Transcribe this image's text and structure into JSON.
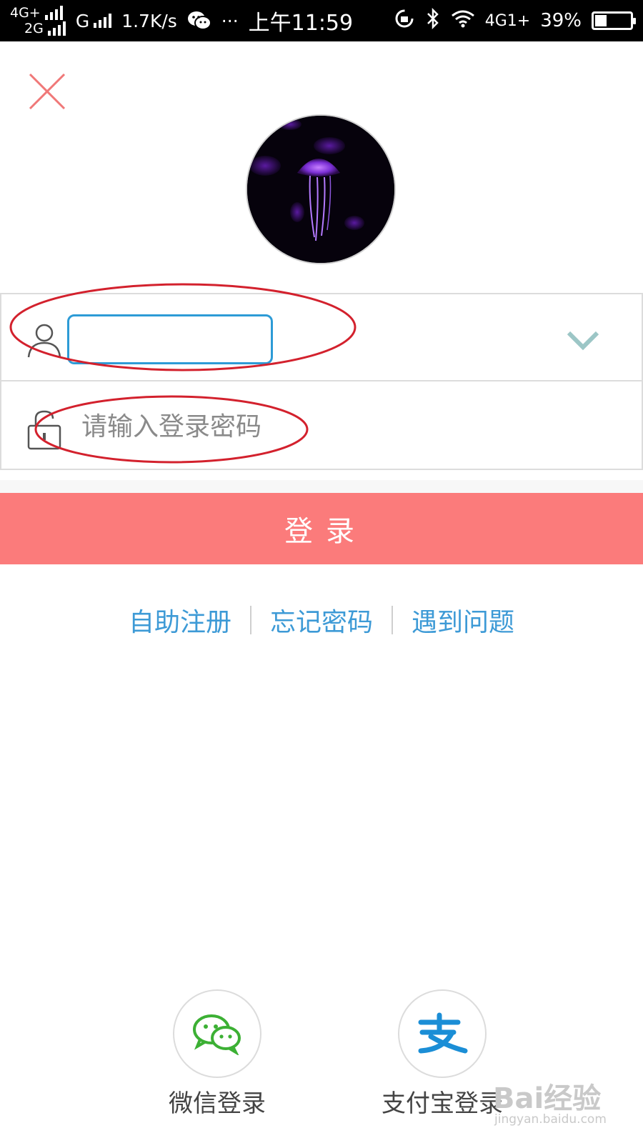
{
  "status_bar": {
    "net1": "4G+",
    "net2": "2G",
    "net3": "G",
    "speed": "1.7K/s",
    "dots": "···",
    "time": "上午11:59",
    "net_right": "4G1+",
    "battery": "39%"
  },
  "login_form": {
    "username_value": "",
    "password_placeholder": "请输入登录密码"
  },
  "login_button": "登录",
  "links": {
    "register": "自助注册",
    "forgot": "忘记密码",
    "problem": "遇到问题"
  },
  "third_party": {
    "wechat_label": "微信登录",
    "alipay_label": "支付宝登录"
  },
  "watermark": {
    "brand": "Bai经验",
    "url": "jingyan.baidu.com"
  },
  "colors": {
    "login_button": "#fb7b7b",
    "link": "#3d9ad6",
    "input_focus": "#2d9bd6",
    "annotation": "#d3212d",
    "close_icon": "#f07878"
  },
  "icons": [
    "close-icon",
    "user-icon",
    "lock-icon",
    "chevron-down-icon",
    "wechat-icon",
    "alipay-icon"
  ]
}
